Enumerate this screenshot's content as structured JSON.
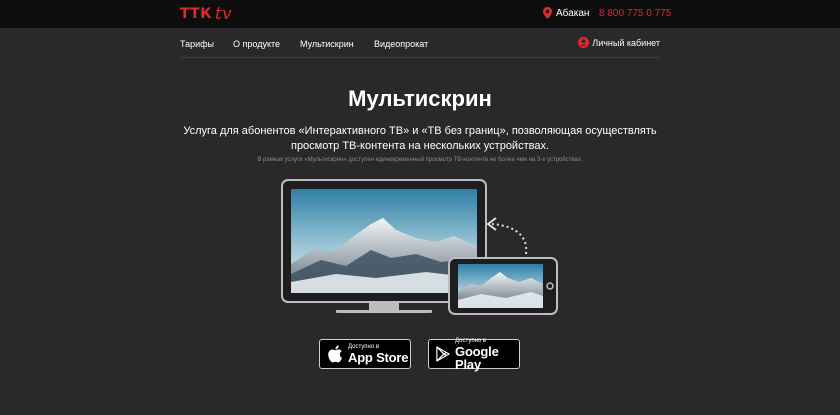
{
  "header": {
    "logo_text": "ТТК",
    "logo_suffix": "tv",
    "city": "Абакан",
    "phone": "8 800 775 0 775",
    "accent_color": "#e5262e"
  },
  "nav": {
    "items": [
      {
        "label": "Тарифы"
      },
      {
        "label": "О продукте"
      },
      {
        "label": "Мультискрин"
      },
      {
        "label": "Видеопрокат"
      }
    ],
    "cabinet_label": "Личный кабинет"
  },
  "main": {
    "title": "Мультискрин",
    "subtitle": "Услуга для абонентов «Интерактивного ТВ» и «ТВ без границ», позволяющая осуществлять просмотр ТВ-контента на нескольких устройствах.",
    "note": "В рамках услуги «Мультискрин» доступен единовременный просмотр ТВ-контента не более чем на 3-х устройствах."
  },
  "stores": {
    "apple": {
      "small": "Доступно в",
      "big": "App Store",
      "icon": "apple-icon"
    },
    "google": {
      "small": "Доступно в",
      "big": "Google Play",
      "icon": "google-play-icon"
    }
  }
}
